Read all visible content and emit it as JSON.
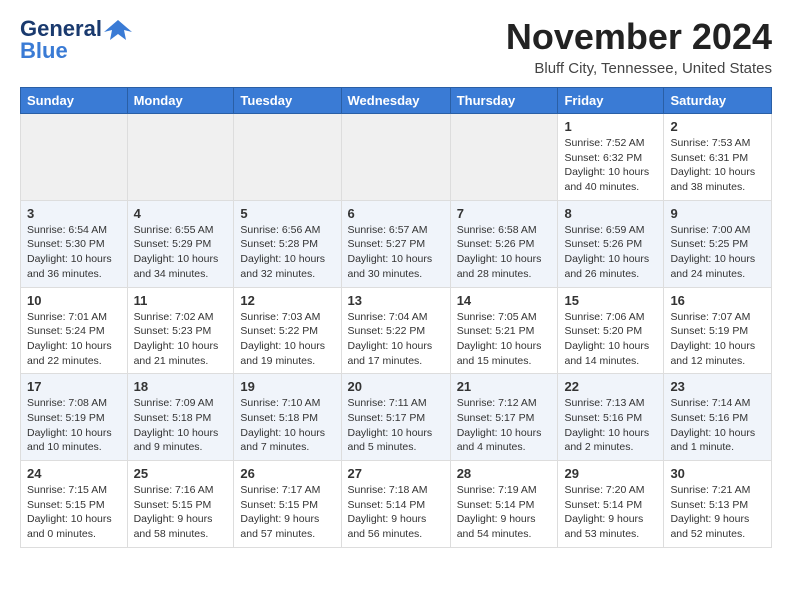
{
  "header": {
    "logo_general": "General",
    "logo_blue": "Blue",
    "month_title": "November 2024",
    "location": "Bluff City, Tennessee, United States"
  },
  "weekdays": [
    "Sunday",
    "Monday",
    "Tuesday",
    "Wednesday",
    "Thursday",
    "Friday",
    "Saturday"
  ],
  "weeks": [
    [
      {
        "day": "",
        "info": ""
      },
      {
        "day": "",
        "info": ""
      },
      {
        "day": "",
        "info": ""
      },
      {
        "day": "",
        "info": ""
      },
      {
        "day": "",
        "info": ""
      },
      {
        "day": "1",
        "info": "Sunrise: 7:52 AM\nSunset: 6:32 PM\nDaylight: 10 hours and 40 minutes."
      },
      {
        "day": "2",
        "info": "Sunrise: 7:53 AM\nSunset: 6:31 PM\nDaylight: 10 hours and 38 minutes."
      }
    ],
    [
      {
        "day": "3",
        "info": "Sunrise: 6:54 AM\nSunset: 5:30 PM\nDaylight: 10 hours and 36 minutes."
      },
      {
        "day": "4",
        "info": "Sunrise: 6:55 AM\nSunset: 5:29 PM\nDaylight: 10 hours and 34 minutes."
      },
      {
        "day": "5",
        "info": "Sunrise: 6:56 AM\nSunset: 5:28 PM\nDaylight: 10 hours and 32 minutes."
      },
      {
        "day": "6",
        "info": "Sunrise: 6:57 AM\nSunset: 5:27 PM\nDaylight: 10 hours and 30 minutes."
      },
      {
        "day": "7",
        "info": "Sunrise: 6:58 AM\nSunset: 5:26 PM\nDaylight: 10 hours and 28 minutes."
      },
      {
        "day": "8",
        "info": "Sunrise: 6:59 AM\nSunset: 5:26 PM\nDaylight: 10 hours and 26 minutes."
      },
      {
        "day": "9",
        "info": "Sunrise: 7:00 AM\nSunset: 5:25 PM\nDaylight: 10 hours and 24 minutes."
      }
    ],
    [
      {
        "day": "10",
        "info": "Sunrise: 7:01 AM\nSunset: 5:24 PM\nDaylight: 10 hours and 22 minutes."
      },
      {
        "day": "11",
        "info": "Sunrise: 7:02 AM\nSunset: 5:23 PM\nDaylight: 10 hours and 21 minutes."
      },
      {
        "day": "12",
        "info": "Sunrise: 7:03 AM\nSunset: 5:22 PM\nDaylight: 10 hours and 19 minutes."
      },
      {
        "day": "13",
        "info": "Sunrise: 7:04 AM\nSunset: 5:22 PM\nDaylight: 10 hours and 17 minutes."
      },
      {
        "day": "14",
        "info": "Sunrise: 7:05 AM\nSunset: 5:21 PM\nDaylight: 10 hours and 15 minutes."
      },
      {
        "day": "15",
        "info": "Sunrise: 7:06 AM\nSunset: 5:20 PM\nDaylight: 10 hours and 14 minutes."
      },
      {
        "day": "16",
        "info": "Sunrise: 7:07 AM\nSunset: 5:19 PM\nDaylight: 10 hours and 12 minutes."
      }
    ],
    [
      {
        "day": "17",
        "info": "Sunrise: 7:08 AM\nSunset: 5:19 PM\nDaylight: 10 hours and 10 minutes."
      },
      {
        "day": "18",
        "info": "Sunrise: 7:09 AM\nSunset: 5:18 PM\nDaylight: 10 hours and 9 minutes."
      },
      {
        "day": "19",
        "info": "Sunrise: 7:10 AM\nSunset: 5:18 PM\nDaylight: 10 hours and 7 minutes."
      },
      {
        "day": "20",
        "info": "Sunrise: 7:11 AM\nSunset: 5:17 PM\nDaylight: 10 hours and 5 minutes."
      },
      {
        "day": "21",
        "info": "Sunrise: 7:12 AM\nSunset: 5:17 PM\nDaylight: 10 hours and 4 minutes."
      },
      {
        "day": "22",
        "info": "Sunrise: 7:13 AM\nSunset: 5:16 PM\nDaylight: 10 hours and 2 minutes."
      },
      {
        "day": "23",
        "info": "Sunrise: 7:14 AM\nSunset: 5:16 PM\nDaylight: 10 hours and 1 minute."
      }
    ],
    [
      {
        "day": "24",
        "info": "Sunrise: 7:15 AM\nSunset: 5:15 PM\nDaylight: 10 hours and 0 minutes."
      },
      {
        "day": "25",
        "info": "Sunrise: 7:16 AM\nSunset: 5:15 PM\nDaylight: 9 hours and 58 minutes."
      },
      {
        "day": "26",
        "info": "Sunrise: 7:17 AM\nSunset: 5:15 PM\nDaylight: 9 hours and 57 minutes."
      },
      {
        "day": "27",
        "info": "Sunrise: 7:18 AM\nSunset: 5:14 PM\nDaylight: 9 hours and 56 minutes."
      },
      {
        "day": "28",
        "info": "Sunrise: 7:19 AM\nSunset: 5:14 PM\nDaylight: 9 hours and 54 minutes."
      },
      {
        "day": "29",
        "info": "Sunrise: 7:20 AM\nSunset: 5:14 PM\nDaylight: 9 hours and 53 minutes."
      },
      {
        "day": "30",
        "info": "Sunrise: 7:21 AM\nSunset: 5:13 PM\nDaylight: 9 hours and 52 minutes."
      }
    ]
  ]
}
